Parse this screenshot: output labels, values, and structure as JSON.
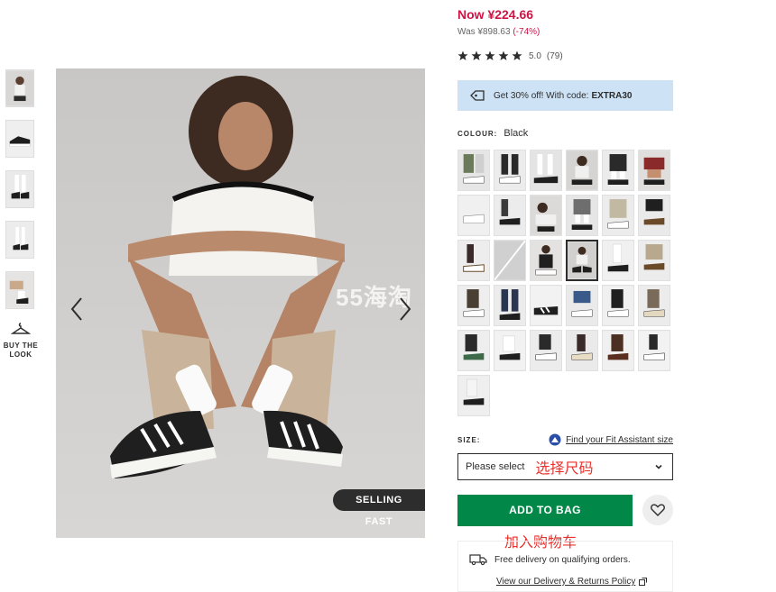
{
  "price": {
    "now": "Now ¥224.66",
    "was": "Was ¥898.63",
    "discount": "(-74%)"
  },
  "rating": {
    "stars": 5,
    "value": "5.0",
    "count": "(79)"
  },
  "promo": {
    "text": "Get 30% off! With code:",
    "code": "EXTRA30"
  },
  "colour": {
    "label": "COLOUR:",
    "value": "Black"
  },
  "gallery": {
    "buy_the_look": "BUY THE LOOK",
    "badge": "SELLING FAST",
    "watermark": "55海淘"
  },
  "size": {
    "label": "SIZE:",
    "fit_link": "Find your Fit Assistant size",
    "placeholder": "Please select",
    "annotation": "选择尺码"
  },
  "actions": {
    "add_to_bag": "ADD TO BAG",
    "add_annotation": "加入购物车"
  },
  "delivery": {
    "free_text": "Free delivery on qualifying orders.",
    "link": "View our Delivery & Returns Policy"
  },
  "colors": {
    "price_red": "#d01345",
    "promo_bg": "#cde2f5",
    "add_green": "#018849",
    "annotation_red": "#e8312d"
  }
}
